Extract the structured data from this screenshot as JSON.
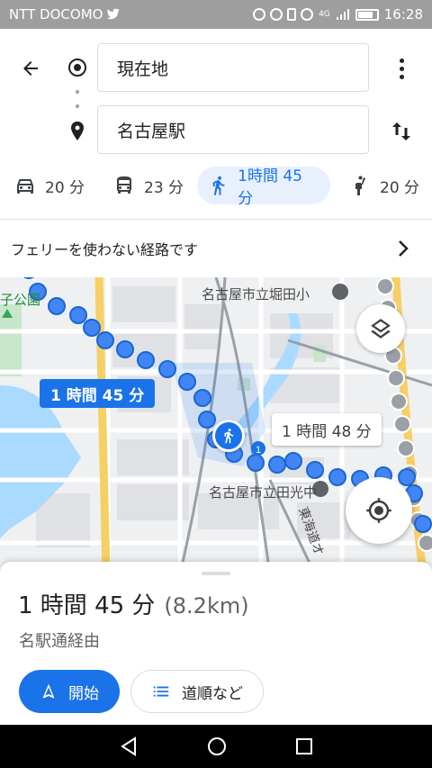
{
  "status_bar": {
    "carrier": "NTT DOCOMO",
    "time": "16:28",
    "signal_label": "4G"
  },
  "header": {
    "origin": "現在地",
    "destination": "名古屋駅"
  },
  "modes": [
    {
      "name": "car",
      "duration": "20 分"
    },
    {
      "name": "transit",
      "duration": "23 分"
    },
    {
      "name": "walk",
      "duration": "1時間 45 分",
      "selected": true
    },
    {
      "name": "ride",
      "duration": "20 分"
    }
  ],
  "notice": "フェリーを使わない経路です",
  "map": {
    "labels": {
      "park": "子公園",
      "school_north": "名古屋市立堀田小",
      "school_south": "名古屋市立田光中",
      "road": "東海道オ",
      "route_shield": "1"
    },
    "route_main_badge": "1 時間 45 分",
    "route_alt_badge": "1 時間 48 分"
  },
  "sheet": {
    "duration": "1 時間 45 分",
    "distance": "(8.2km)",
    "via": "名駅通経由",
    "start_label": "開始",
    "steps_label": "道順など"
  },
  "colors": {
    "accent": "#1a73e8",
    "route_main": "#4285f4",
    "route_alt": "#9aa0a6",
    "highway": "#f6cf65"
  }
}
